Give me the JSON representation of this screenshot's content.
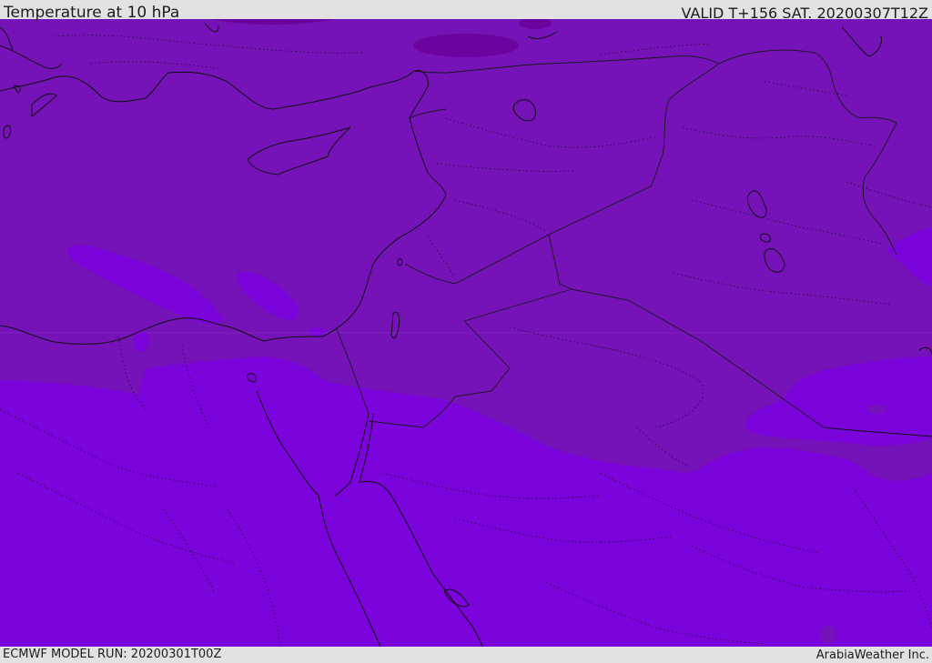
{
  "header": {
    "title": "Temperature at 10 hPa",
    "valid_time": "VALID T+156 SAT. 20200307T12Z"
  },
  "footer": {
    "model_run": "ECMWF MODEL RUN: 20200301T00Z",
    "credit": "ArabiaWeather Inc."
  },
  "map": {
    "colors": {
      "warm_band": "#7512b8",
      "cool_band": "#7b03db",
      "cold_core": "#6b049e",
      "coastline": "#111111",
      "border": "#1a1a1a"
    }
  }
}
